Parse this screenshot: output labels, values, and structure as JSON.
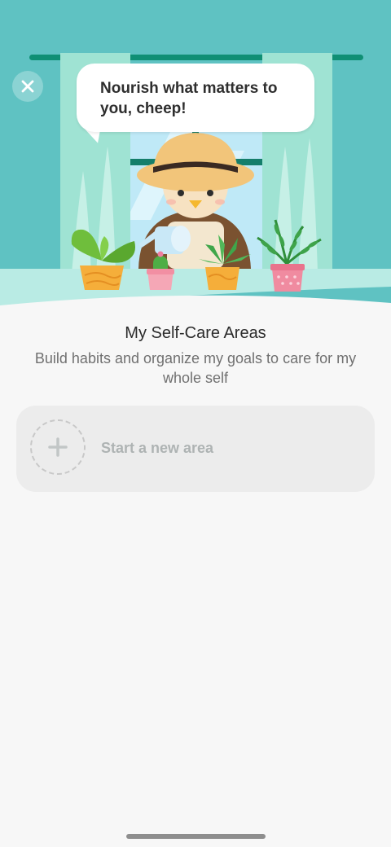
{
  "colors": {
    "sky": "#5fc2c2",
    "curtain": "#9fe3d3",
    "rod": "#0f8f74",
    "page_bg": "#f7f7f7",
    "card_bg": "#ececec"
  },
  "header": {
    "close_icon": "close-icon",
    "speech": "Nourish what matters to you, cheep!"
  },
  "main": {
    "title": "My Self-Care Areas",
    "subtitle": "Build habits and organize my goals to care for my whole self",
    "new_area": {
      "icon": "plus-icon",
      "label": "Start a new area"
    }
  }
}
